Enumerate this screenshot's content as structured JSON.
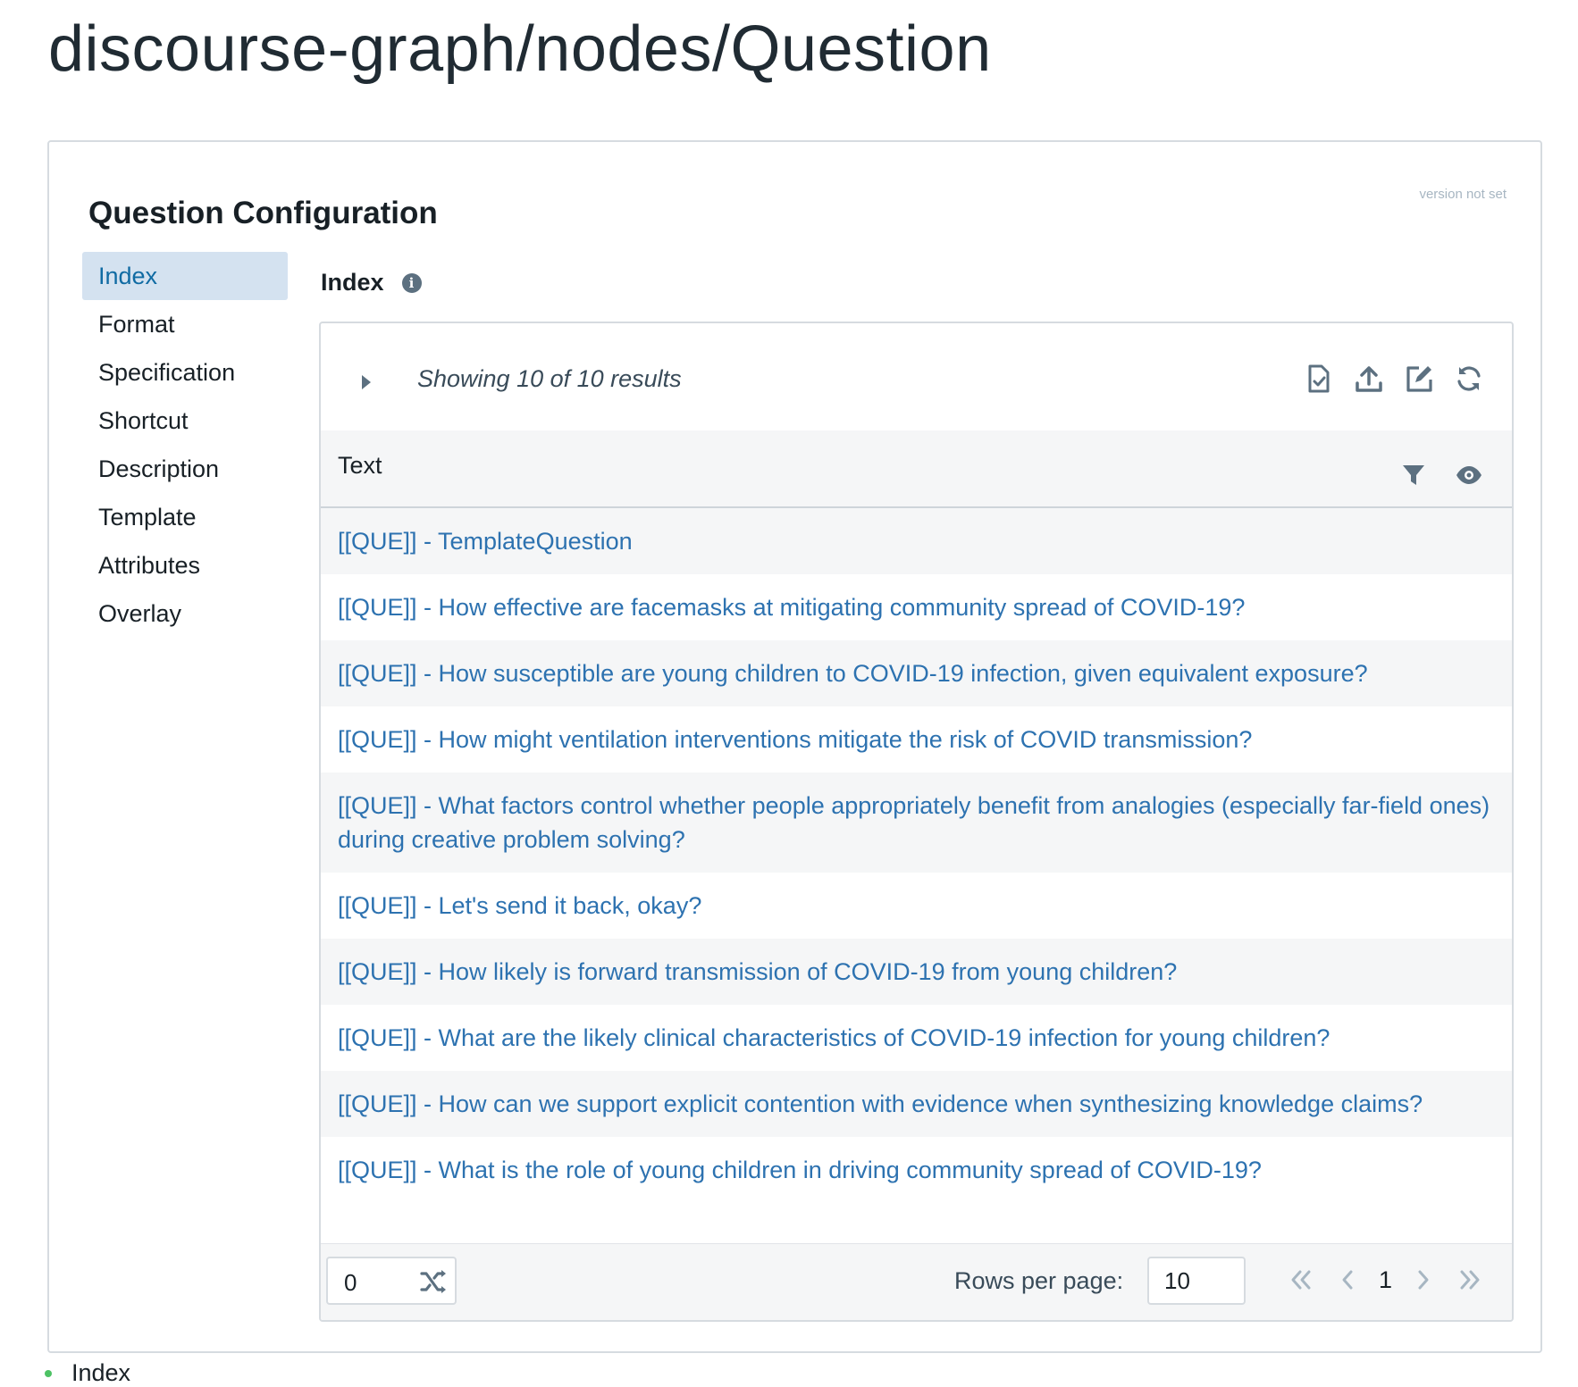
{
  "page": {
    "title": "discourse-graph/nodes/Question"
  },
  "card": {
    "title": "Question Configuration",
    "version": "version not set",
    "tabs": [
      "Index",
      "Format",
      "Specification",
      "Shortcut",
      "Description",
      "Template",
      "Attributes",
      "Overlay"
    ],
    "active_tab": "Index"
  },
  "panel": {
    "title": "Index",
    "info_icon": "info-icon"
  },
  "results": {
    "summary": "Showing 10 of 10 results",
    "toolbar_icons": [
      "export-file-icon",
      "upload-icon",
      "edit-icon",
      "refresh-icon"
    ],
    "column_title": "Text",
    "column_icons": [
      "filter-icon",
      "eye-icon"
    ],
    "rows": [
      "[[QUE]] - TemplateQuestion",
      "[[QUE]] - How effective are facemasks at mitigating community spread of COVID-19?",
      "[[QUE]] - How susceptible are young children to COVID-19 infection, given equivalent exposure?",
      "[[QUE]] - How might ventilation interventions mitigate the risk of COVID transmission?",
      "[[QUE]] - What factors control whether people appropriately benefit from analogies (especially far-field ones) during creative problem solving?",
      "[[QUE]] - Let's send it back, okay?",
      "[[QUE]] - How likely is forward transmission of COVID-19 from young children?",
      "[[QUE]] - What are the likely clinical characteristics of COVID-19 infection for young children?",
      "[[QUE]] - How can we support explicit contention with evidence when synthesizing knowledge claims?",
      "[[QUE]] - What is the role of young children in driving community spread of COVID-19?"
    ]
  },
  "footer": {
    "random_value": "0",
    "rows_per_page_label": "Rows per page:",
    "rows_per_page_value": "10",
    "current_page": "1"
  },
  "outline": {
    "item": "Index"
  },
  "colors": {
    "accent": "#106ba3",
    "link": "#2d72b0",
    "active_tab_bg": "#d4e2f0",
    "stripe": "#f5f6f7",
    "bullet": "#4dc264"
  }
}
